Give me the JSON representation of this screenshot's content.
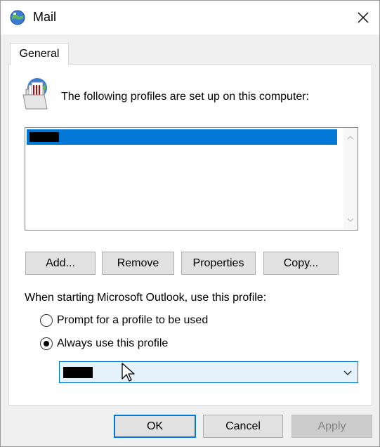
{
  "window": {
    "title": "Mail",
    "icon": "mail-globe-icon",
    "close_icon": "close-icon"
  },
  "tabs": [
    {
      "label": "General",
      "selected": true
    }
  ],
  "profiles": {
    "label": "The following profiles are set up on this computer:",
    "icon": "profiles-icon",
    "items": [
      {
        "selected": true,
        "redacted": true
      }
    ]
  },
  "buttons": {
    "add": "Add...",
    "remove": "Remove",
    "properties": "Properties",
    "copy": "Copy..."
  },
  "startup": {
    "label": "When starting Microsoft Outlook, use this profile:",
    "options": [
      {
        "label": "Prompt for a profile to be used",
        "checked": false
      },
      {
        "label": "Always use this profile",
        "checked": true
      }
    ],
    "selected_profile_redacted": true
  },
  "footer": {
    "ok": "OK",
    "cancel": "Cancel",
    "apply": "Apply",
    "apply_disabled": true
  },
  "colors": {
    "selection": "#0078d7",
    "combo_bg": "#e5f1fb"
  }
}
